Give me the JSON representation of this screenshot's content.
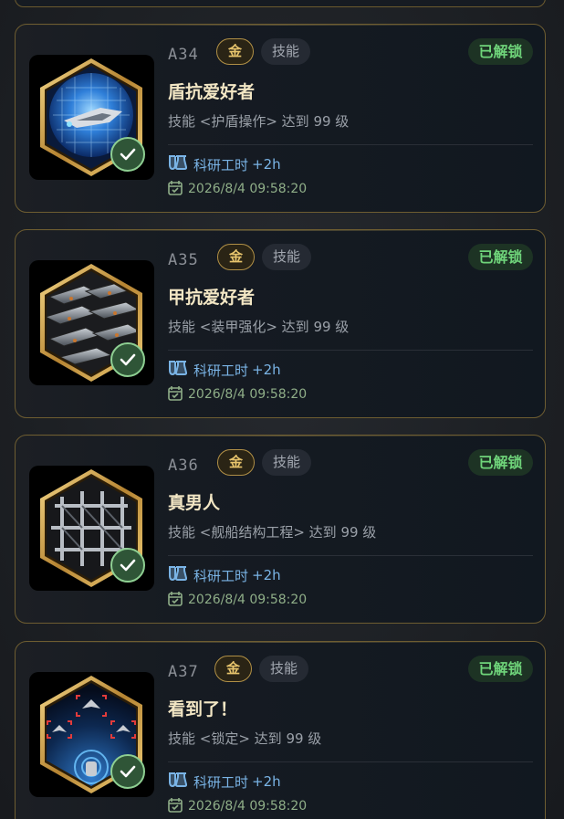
{
  "cards": [
    {
      "code": "A34",
      "rarity": "金",
      "type": "技能",
      "status": "已解锁",
      "title": "盾抗爱好者",
      "description": "技能 <护盾操作> 达到 99 级",
      "reward_label": "科研工时",
      "reward_value": "+2h",
      "date": "2026/8/4 09:58:20",
      "icon": "shield-ship-icon"
    },
    {
      "code": "A35",
      "rarity": "金",
      "type": "技能",
      "status": "已解锁",
      "title": "甲抗爱好者",
      "description": "技能 <装甲强化> 达到 99 级",
      "reward_label": "科研工时",
      "reward_value": "+2h",
      "date": "2026/8/4 09:58:20",
      "icon": "armor-plates-icon"
    },
    {
      "code": "A36",
      "rarity": "金",
      "type": "技能",
      "status": "已解锁",
      "title": "真男人",
      "description": "技能 <舰船结构工程> 达到 99 级",
      "reward_label": "科研工时",
      "reward_value": "+2h",
      "date": "2026/8/4 09:58:20",
      "icon": "ship-frame-icon"
    },
    {
      "code": "A37",
      "rarity": "金",
      "type": "技能",
      "status": "已解锁",
      "title": "看到了！",
      "description": "技能 <锁定> 达到 99 级",
      "reward_label": "科研工时",
      "reward_value": "+2h",
      "date": "2026/8/4 09:58:20",
      "icon": "target-lock-icon"
    }
  ],
  "colors": {
    "gold": "#e7c46c",
    "unlocked_green": "#6fd47a",
    "reward_blue": "#7ab4e6",
    "date_green": "#8fae88"
  }
}
